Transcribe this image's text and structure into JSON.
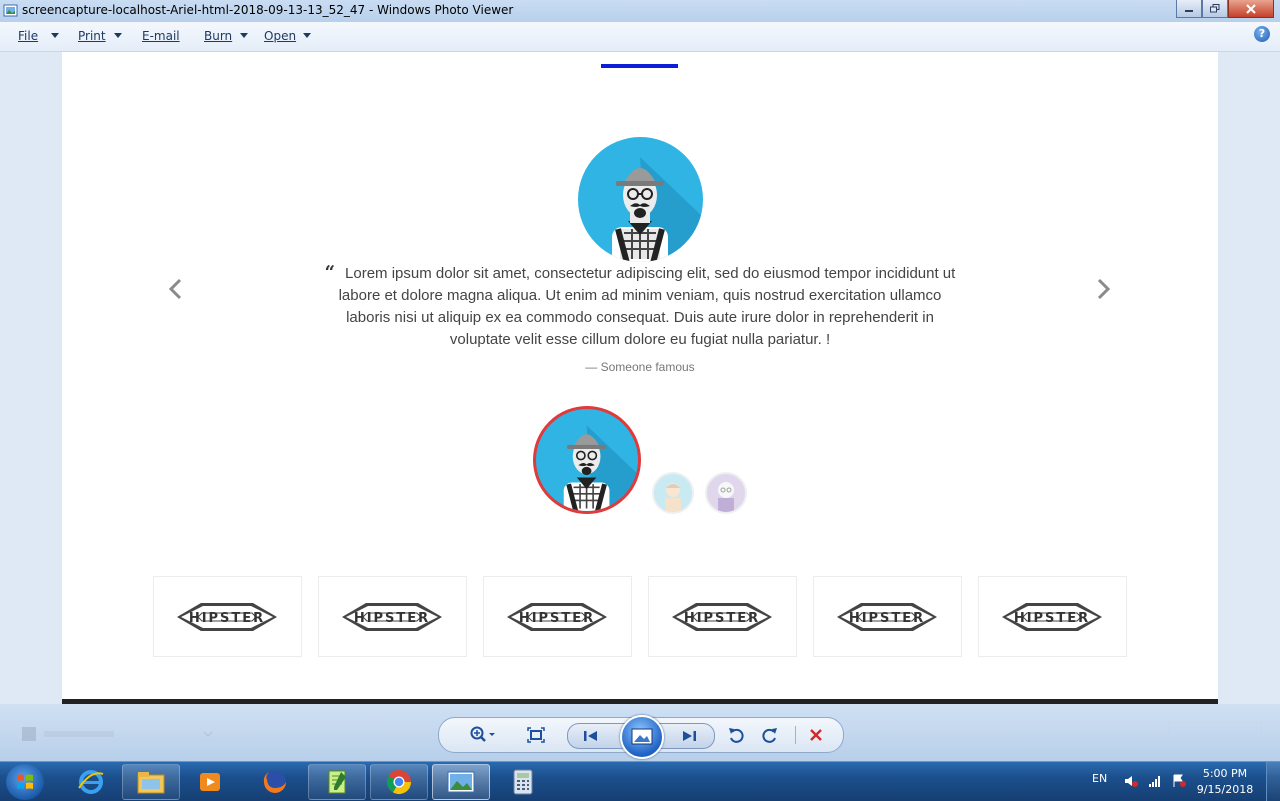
{
  "window": {
    "title": "screencapture-localhost-Ariel-html-2018-09-13-13_52_47 - Windows Photo Viewer"
  },
  "menu": {
    "items": [
      {
        "label": "File",
        "has_dropdown": true
      },
      {
        "label": "Print",
        "has_dropdown": true
      },
      {
        "label": "E-mail",
        "has_dropdown": false
      },
      {
        "label": "Burn",
        "has_dropdown": true
      },
      {
        "label": "Open",
        "has_dropdown": true
      }
    ],
    "help": "?"
  },
  "testimonial": {
    "quote": "Lorem ipsum dolor sit amet, consectetur adipiscing elit, sed do eiusmod tempor incididunt ut labore et dolore magna aliqua. Ut enim ad minim veniam, quis nostrud exercitation ullamco laboris nisi ut aliquip ex ea commodo consequat. Duis aute irure dolor in reprehenderit in voluptate velit esse cillum dolore eu fugiat nulla pariatur. !",
    "author": "— Someone famous",
    "accent_color": "#0d1fd6",
    "active_border_color": "#e03a3a",
    "avatar_bg": "#2fb4e4"
  },
  "logos": {
    "items": [
      "HIPSTER",
      "HIPSTER",
      "HIPSTER",
      "HIPSTER",
      "HIPSTER",
      "HIPSTER"
    ]
  },
  "controls": {
    "icons": [
      "zoom-icon",
      "fit-window-icon",
      "previous-icon",
      "slideshow-icon",
      "next-icon",
      "rotate-counterclockwise-icon",
      "rotate-clockwise-icon",
      "delete-icon"
    ]
  },
  "taskbar": {
    "apps": [
      "internet-explorer-icon",
      "windows-explorer-icon",
      "media-player-icon",
      "firefox-icon",
      "notepad-plus-plus-icon",
      "chrome-icon",
      "photo-viewer-icon",
      "calculator-icon"
    ],
    "language": "EN",
    "time": "5:00 PM",
    "date": "9/15/2018"
  }
}
